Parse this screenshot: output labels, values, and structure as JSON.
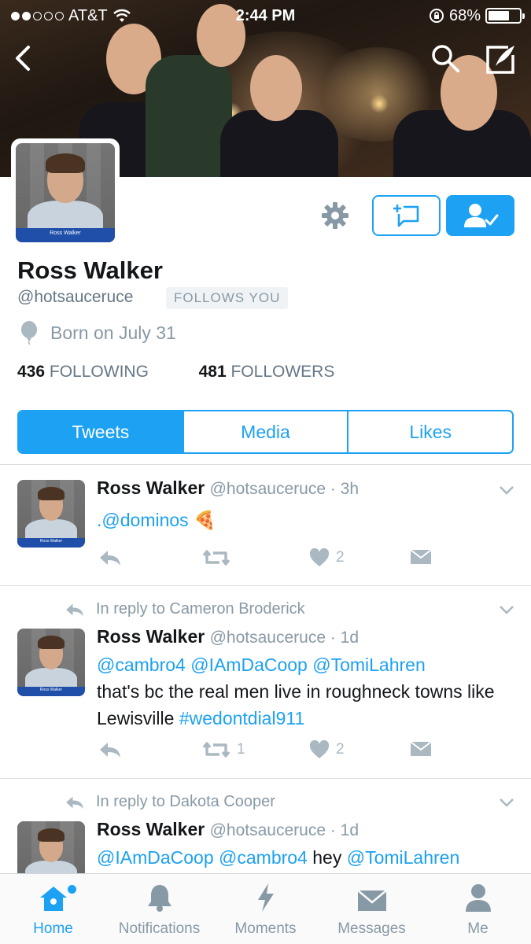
{
  "status_bar": {
    "carrier": "AT&T",
    "time": "2:44 PM",
    "battery": "68%"
  },
  "profile": {
    "name": "Ross Walker",
    "handle": "@hotsauceruce",
    "follows_you": "FOLLOWS YOU",
    "birthday": "Born on July 31",
    "following_count": "436",
    "following_label": "FOLLOWING",
    "followers_count": "481",
    "followers_label": "FOLLOWERS",
    "avatar_caption": "Ross Walker"
  },
  "tabs": [
    {
      "label": "Tweets",
      "active": true
    },
    {
      "label": "Media",
      "active": false
    },
    {
      "label": "Likes",
      "active": false
    }
  ],
  "tweets": [
    {
      "name": "Ross Walker",
      "meta": "@hotsauceruce · 3h",
      "reply_context": "",
      "text_link": ".@dominos",
      "text_emoji": "🍕",
      "retweets": "",
      "likes": "2"
    },
    {
      "name": "Ross Walker",
      "meta": "@hotsauceruce · 1d",
      "reply_context": "In reply to Cameron Broderick",
      "mentions": "@cambro4 @IAmDaCoop @TomiLahren",
      "text_plain": "that's bc the real men live in roughneck towns like Lewisville",
      "hashtag": "#wedontdial911",
      "retweets": "1",
      "likes": "2"
    },
    {
      "name": "Ross Walker",
      "meta": "@hotsauceruce · 1d",
      "reply_context": "In reply to Dakota Cooper",
      "mentions_a": "@IAmDaCoop @cambro4",
      "text_plain": "hey",
      "mentions_b": "@TomiLahren"
    }
  ],
  "tabbar": [
    {
      "label": "Home",
      "icon": "home-icon",
      "active": true
    },
    {
      "label": "Notifications",
      "icon": "bell-icon",
      "active": false
    },
    {
      "label": "Moments",
      "icon": "lightning-icon",
      "active": false
    },
    {
      "label": "Messages",
      "icon": "envelope-icon",
      "active": false
    },
    {
      "label": "Me",
      "icon": "person-icon",
      "active": false
    }
  ],
  "colors": {
    "accent": "#1da1f2",
    "muted": "#8899a6",
    "text": "#14171a"
  }
}
